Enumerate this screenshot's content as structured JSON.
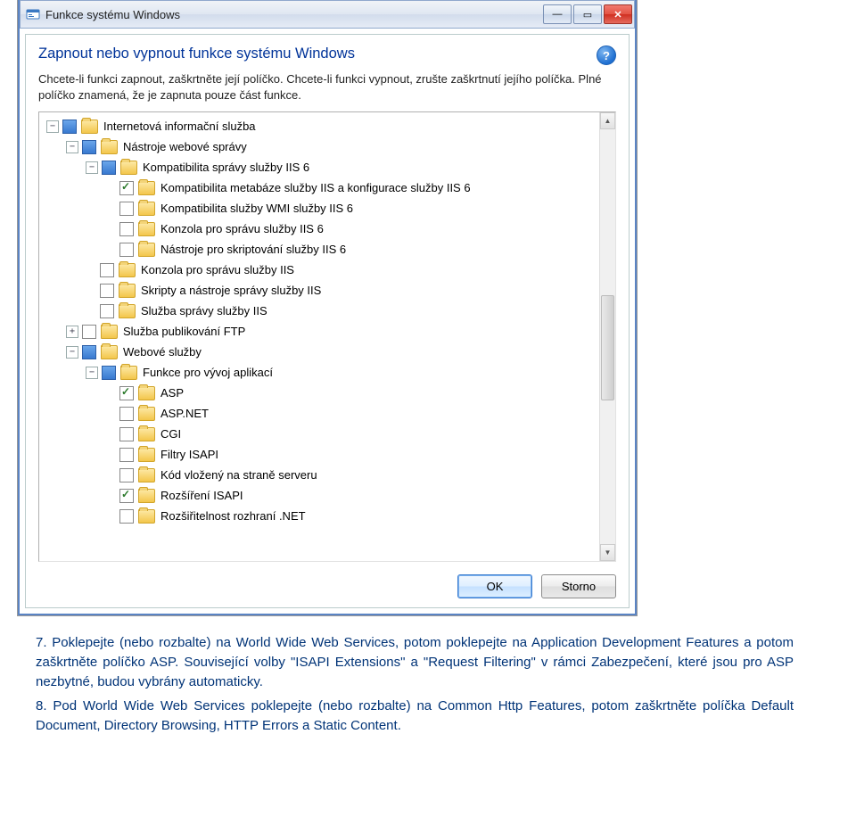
{
  "dialog": {
    "title": "Funkce systému Windows",
    "heading": "Zapnout nebo vypnout funkce systému Windows",
    "description": "Chcete-li funkci zapnout, zaškrtněte její políčko. Chcete-li funkci vypnout, zrušte zaškrtnutí jejího políčka. Plné políčko znamená, že je zapnuta pouze část funkce.",
    "ok": "OK",
    "cancel": "Storno"
  },
  "tree": [
    {
      "indent": 0,
      "exp": "-",
      "check": "partial",
      "label": "Internetová informační služba"
    },
    {
      "indent": 1,
      "exp": "-",
      "check": "partial",
      "label": "Nástroje webové správy"
    },
    {
      "indent": 2,
      "exp": "-",
      "check": "partial",
      "label": "Kompatibilita správy služby IIS 6"
    },
    {
      "indent": 3,
      "exp": "",
      "check": "checked",
      "label": "Kompatibilita metabáze služby IIS a konfigurace služby IIS 6"
    },
    {
      "indent": 3,
      "exp": "",
      "check": "empty",
      "label": "Kompatibilita služby WMI služby IIS 6"
    },
    {
      "indent": 3,
      "exp": "",
      "check": "empty",
      "label": "Konzola pro správu služby IIS 6"
    },
    {
      "indent": 3,
      "exp": "",
      "check": "empty",
      "label": "Nástroje pro skriptování služby IIS 6"
    },
    {
      "indent": 2,
      "exp": "",
      "check": "empty",
      "label": "Konzola pro správu služby IIS"
    },
    {
      "indent": 2,
      "exp": "",
      "check": "empty",
      "label": "Skripty a nástroje správy služby IIS"
    },
    {
      "indent": 2,
      "exp": "",
      "check": "empty",
      "label": "Služba správy služby IIS"
    },
    {
      "indent": 1,
      "exp": "+",
      "check": "empty",
      "label": "Služba publikování FTP"
    },
    {
      "indent": 1,
      "exp": "-",
      "check": "partial",
      "label": "Webové služby"
    },
    {
      "indent": 2,
      "exp": "-",
      "check": "partial",
      "label": "Funkce pro vývoj aplikací"
    },
    {
      "indent": 3,
      "exp": "",
      "check": "checked",
      "label": "ASP"
    },
    {
      "indent": 3,
      "exp": "",
      "check": "empty",
      "label": "ASP.NET"
    },
    {
      "indent": 3,
      "exp": "",
      "check": "empty",
      "label": "CGI"
    },
    {
      "indent": 3,
      "exp": "",
      "check": "empty",
      "label": "Filtry ISAPI"
    },
    {
      "indent": 3,
      "exp": "",
      "check": "empty",
      "label": "Kód vložený na straně serveru"
    },
    {
      "indent": 3,
      "exp": "",
      "check": "checked",
      "label": "Rozšíření ISAPI"
    },
    {
      "indent": 3,
      "exp": "",
      "check": "empty",
      "label": "Rozšiřitelnost rozhraní .NET"
    }
  ],
  "doc": {
    "p1": "7. Poklepejte (nebo rozbalte) na World Wide Web Services, potom poklepejte na Application Development Features a potom zaškrtněte políčko ASP. Související volby \"ISAPI Extensions\" a \"Request Filtering\" v rámci Zabezpečení, které jsou pro ASP nezbytné, budou vybrány automaticky.",
    "p2": "8. Pod World Wide Web Services poklepejte (nebo rozbalte) na Common Http Features, potom zaškrtněte políčka Default Document, Directory Browsing, HTTP Errors a Static Content."
  }
}
